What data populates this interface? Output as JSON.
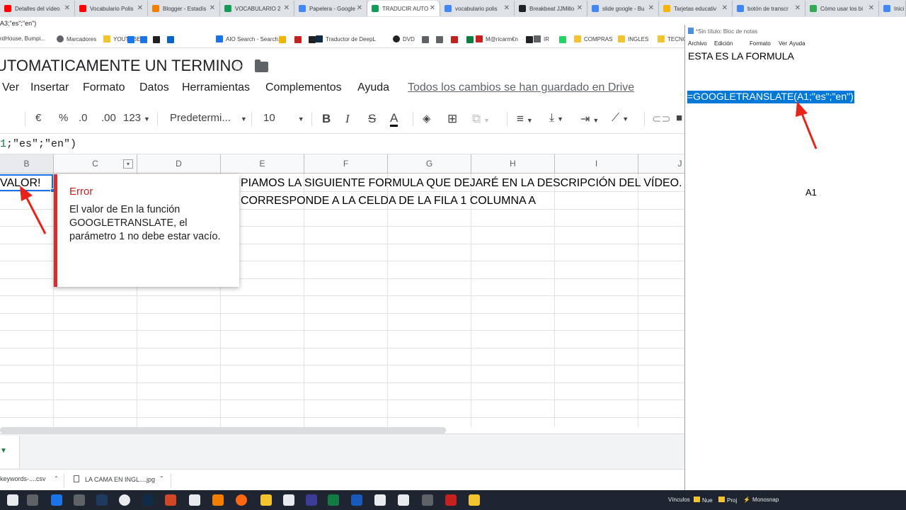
{
  "browser": {
    "tabs": [
      {
        "label": "Detalles del vídeo",
        "color": "#ff0000"
      },
      {
        "label": "Vocabulario Polis",
        "color": "#ff0000"
      },
      {
        "label": "Blogger - Estadís",
        "color": "#f57d00"
      },
      {
        "label": "VOCABULARIO 2",
        "color": "#0f9d58"
      },
      {
        "label": "Papelera - Google",
        "color": "#4285f4"
      },
      {
        "label": "TRADUCIR AUTO",
        "color": "#0f9d58"
      },
      {
        "label": "vocabulario polis",
        "color": "#4285f4"
      },
      {
        "label": "Breakbeat JJMillo",
        "color": "#202124"
      },
      {
        "label": "slide google - Bu",
        "color": "#4285f4"
      },
      {
        "label": "Tarjetas educativ",
        "color": "#f4b400"
      },
      {
        "label": "botón de transcr",
        "color": "#4285f4"
      },
      {
        "label": "Cómo usar los bi",
        "color": "#34a853"
      },
      {
        "label": "Inici",
        "color": "#4285f4"
      }
    ],
    "url_fragment": "A3;\"es\";\"en\")",
    "bookmarks": [
      {
        "label": "rdHouse, Bumpi...",
        "icon": "page-icon"
      },
      {
        "label": "Marcadores",
        "icon": "star-icon"
      },
      {
        "label": "YOUTUBE",
        "icon": "folder-icon"
      },
      {
        "label": "AIO Search - Search...",
        "icon": "search-icon"
      },
      {
        "label": "Traductor de DeepL",
        "icon": "deepl-icon"
      },
      {
        "label": "DVD",
        "icon": "disc-icon"
      },
      {
        "label": "M@ricarm€n",
        "icon": "mail-icon"
      },
      {
        "label": "IR",
        "icon": "arrow-icon"
      },
      {
        "label": "COMPRAS",
        "icon": "folder-icon"
      },
      {
        "label": "INGLES",
        "icon": "folder-icon"
      },
      {
        "label": "TECNO",
        "icon": "folder-icon"
      }
    ]
  },
  "sheets": {
    "title": "UTOMATICAMENTE UN TERMINO",
    "menu": [
      "Ver",
      "Insertar",
      "Formato",
      "Datos",
      "Herramientas",
      "Complementos",
      "Ayuda"
    ],
    "saved_status": "Todos los cambios se han guardado en Drive",
    "toolbar": {
      "currency": "€",
      "percent": "%",
      "dec_less": ".0",
      "dec_more": ".00",
      "format_more": "123",
      "font": "Predetermi...",
      "font_size": "10"
    },
    "formula_fragment": {
      "ref": "1",
      "rest": ";\"es\";\"en\")"
    },
    "columns": [
      "B",
      "C",
      "D",
      "E",
      "F",
      "G",
      "H",
      "I",
      "J"
    ],
    "cells": {
      "b1": "VALOR!",
      "e1": "PIAMOS LA SIGUIENTE FORMULA QUE DEJARÉ EN LA DESCRIPCIÓN DEL VÍDEO.",
      "e2": "CORRESPONDE A LA CELDA DE LA FILA 1 COLUMNA A"
    },
    "error": {
      "title": "Error",
      "message": "El valor de En la función GOOGLETRANSLATE, el parámetro 1 no debe estar vacío."
    }
  },
  "downloads": [
    {
      "label": "keywords-....csv"
    },
    {
      "label": "LA CAMA EN INGL....jpg"
    }
  ],
  "notepad": {
    "title": "*Sin título: Bloc de notas",
    "menu": [
      "Archivo",
      "Edición",
      "Formato",
      "Ver",
      "Ayuda"
    ],
    "line1": "ESTA ES LA FORMULA",
    "formula": "=GOOGLETRANSLATE(A1;\"es\";\"en\")",
    "note": "A1"
  },
  "taskbar": {
    "links_label": "Vínculos",
    "items": [
      "Nue",
      "Proj",
      "Monosnap"
    ]
  }
}
